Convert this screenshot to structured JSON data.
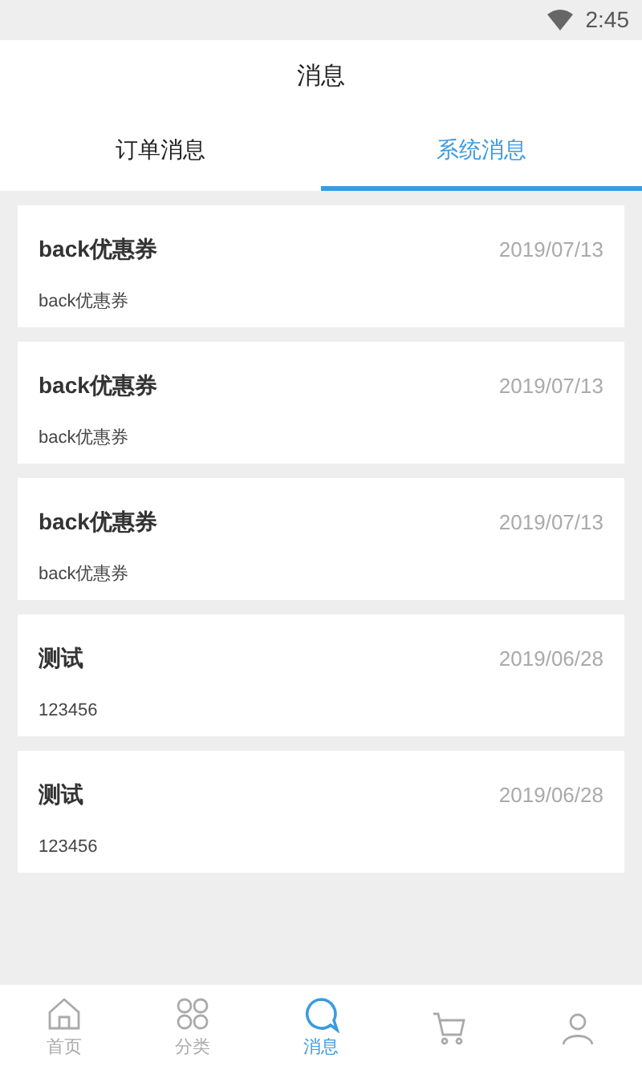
{
  "status_bar": {
    "time": "2:45"
  },
  "header": {
    "title": "消息"
  },
  "tabs": [
    {
      "label": "订单消息",
      "selected": false
    },
    {
      "label": "系统消息",
      "selected": true
    }
  ],
  "messages": [
    {
      "title": "back优惠券",
      "date": "2019/07/13",
      "body": "back优惠券"
    },
    {
      "title": "back优惠券",
      "date": "2019/07/13",
      "body": "back优惠券"
    },
    {
      "title": "back优惠券",
      "date": "2019/07/13",
      "body": "back优惠券"
    },
    {
      "title": "测试",
      "date": "2019/06/28",
      "body": "123456"
    },
    {
      "title": "测试",
      "date": "2019/06/28",
      "body": "123456"
    }
  ],
  "bottom_nav": [
    {
      "kind": "home",
      "label": "首页",
      "selected": false
    },
    {
      "kind": "category",
      "label": "分类",
      "selected": false
    },
    {
      "kind": "message",
      "label": "消息",
      "selected": true
    },
    {
      "kind": "cart",
      "selected": false
    },
    {
      "kind": "user",
      "selected": false
    }
  ]
}
